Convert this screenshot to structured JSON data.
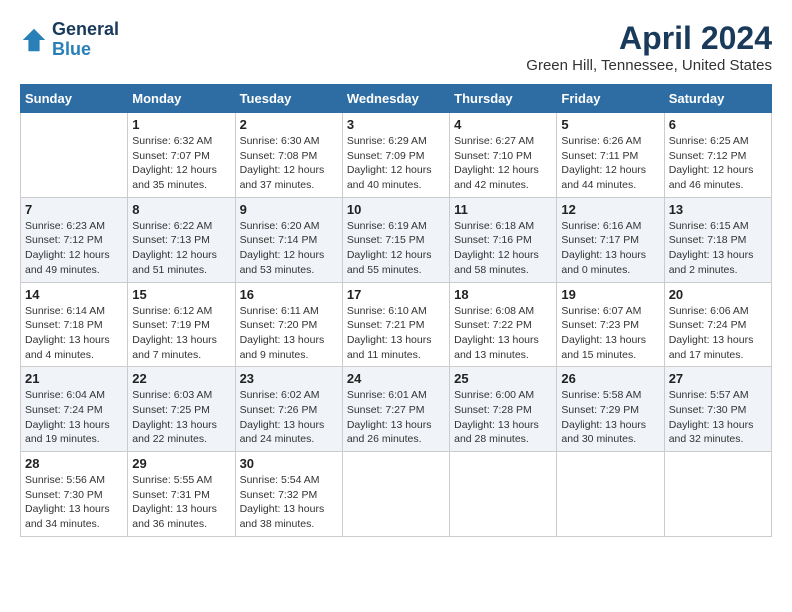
{
  "header": {
    "logo_line1": "General",
    "logo_line2": "Blue",
    "month_title": "April 2024",
    "location": "Green Hill, Tennessee, United States"
  },
  "days_of_week": [
    "Sunday",
    "Monday",
    "Tuesday",
    "Wednesday",
    "Thursday",
    "Friday",
    "Saturday"
  ],
  "weeks": [
    [
      {
        "day": "",
        "info": ""
      },
      {
        "day": "1",
        "info": "Sunrise: 6:32 AM\nSunset: 7:07 PM\nDaylight: 12 hours\nand 35 minutes."
      },
      {
        "day": "2",
        "info": "Sunrise: 6:30 AM\nSunset: 7:08 PM\nDaylight: 12 hours\nand 37 minutes."
      },
      {
        "day": "3",
        "info": "Sunrise: 6:29 AM\nSunset: 7:09 PM\nDaylight: 12 hours\nand 40 minutes."
      },
      {
        "day": "4",
        "info": "Sunrise: 6:27 AM\nSunset: 7:10 PM\nDaylight: 12 hours\nand 42 minutes."
      },
      {
        "day": "5",
        "info": "Sunrise: 6:26 AM\nSunset: 7:11 PM\nDaylight: 12 hours\nand 44 minutes."
      },
      {
        "day": "6",
        "info": "Sunrise: 6:25 AM\nSunset: 7:12 PM\nDaylight: 12 hours\nand 46 minutes."
      }
    ],
    [
      {
        "day": "7",
        "info": "Sunrise: 6:23 AM\nSunset: 7:12 PM\nDaylight: 12 hours\nand 49 minutes."
      },
      {
        "day": "8",
        "info": "Sunrise: 6:22 AM\nSunset: 7:13 PM\nDaylight: 12 hours\nand 51 minutes."
      },
      {
        "day": "9",
        "info": "Sunrise: 6:20 AM\nSunset: 7:14 PM\nDaylight: 12 hours\nand 53 minutes."
      },
      {
        "day": "10",
        "info": "Sunrise: 6:19 AM\nSunset: 7:15 PM\nDaylight: 12 hours\nand 55 minutes."
      },
      {
        "day": "11",
        "info": "Sunrise: 6:18 AM\nSunset: 7:16 PM\nDaylight: 12 hours\nand 58 minutes."
      },
      {
        "day": "12",
        "info": "Sunrise: 6:16 AM\nSunset: 7:17 PM\nDaylight: 13 hours\nand 0 minutes."
      },
      {
        "day": "13",
        "info": "Sunrise: 6:15 AM\nSunset: 7:18 PM\nDaylight: 13 hours\nand 2 minutes."
      }
    ],
    [
      {
        "day": "14",
        "info": "Sunrise: 6:14 AM\nSunset: 7:18 PM\nDaylight: 13 hours\nand 4 minutes."
      },
      {
        "day": "15",
        "info": "Sunrise: 6:12 AM\nSunset: 7:19 PM\nDaylight: 13 hours\nand 7 minutes."
      },
      {
        "day": "16",
        "info": "Sunrise: 6:11 AM\nSunset: 7:20 PM\nDaylight: 13 hours\nand 9 minutes."
      },
      {
        "day": "17",
        "info": "Sunrise: 6:10 AM\nSunset: 7:21 PM\nDaylight: 13 hours\nand 11 minutes."
      },
      {
        "day": "18",
        "info": "Sunrise: 6:08 AM\nSunset: 7:22 PM\nDaylight: 13 hours\nand 13 minutes."
      },
      {
        "day": "19",
        "info": "Sunrise: 6:07 AM\nSunset: 7:23 PM\nDaylight: 13 hours\nand 15 minutes."
      },
      {
        "day": "20",
        "info": "Sunrise: 6:06 AM\nSunset: 7:24 PM\nDaylight: 13 hours\nand 17 minutes."
      }
    ],
    [
      {
        "day": "21",
        "info": "Sunrise: 6:04 AM\nSunset: 7:24 PM\nDaylight: 13 hours\nand 19 minutes."
      },
      {
        "day": "22",
        "info": "Sunrise: 6:03 AM\nSunset: 7:25 PM\nDaylight: 13 hours\nand 22 minutes."
      },
      {
        "day": "23",
        "info": "Sunrise: 6:02 AM\nSunset: 7:26 PM\nDaylight: 13 hours\nand 24 minutes."
      },
      {
        "day": "24",
        "info": "Sunrise: 6:01 AM\nSunset: 7:27 PM\nDaylight: 13 hours\nand 26 minutes."
      },
      {
        "day": "25",
        "info": "Sunrise: 6:00 AM\nSunset: 7:28 PM\nDaylight: 13 hours\nand 28 minutes."
      },
      {
        "day": "26",
        "info": "Sunrise: 5:58 AM\nSunset: 7:29 PM\nDaylight: 13 hours\nand 30 minutes."
      },
      {
        "day": "27",
        "info": "Sunrise: 5:57 AM\nSunset: 7:30 PM\nDaylight: 13 hours\nand 32 minutes."
      }
    ],
    [
      {
        "day": "28",
        "info": "Sunrise: 5:56 AM\nSunset: 7:30 PM\nDaylight: 13 hours\nand 34 minutes."
      },
      {
        "day": "29",
        "info": "Sunrise: 5:55 AM\nSunset: 7:31 PM\nDaylight: 13 hours\nand 36 minutes."
      },
      {
        "day": "30",
        "info": "Sunrise: 5:54 AM\nSunset: 7:32 PM\nDaylight: 13 hours\nand 38 minutes."
      },
      {
        "day": "",
        "info": ""
      },
      {
        "day": "",
        "info": ""
      },
      {
        "day": "",
        "info": ""
      },
      {
        "day": "",
        "info": ""
      }
    ]
  ]
}
